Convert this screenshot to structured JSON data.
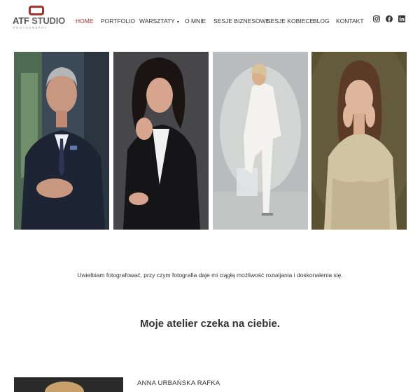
{
  "brand": {
    "logo_text_1": "ATF",
    "logo_text_2": "STUDIO",
    "logo_sub": "PHOTOGRAPHY",
    "accent": "#a8322d"
  },
  "nav": {
    "items": [
      {
        "label": "HOME",
        "active": true
      },
      {
        "label": "PORTFOLIO",
        "active": false
      },
      {
        "label": "WARSZTATY",
        "active": false,
        "has_dropdown": true
      },
      {
        "label": "O MNIE",
        "active": false
      },
      {
        "label": "SESJE BIZNESOWE",
        "active": false
      },
      {
        "label": "SESJE KOBIECE",
        "active": false
      },
      {
        "label": "BLOG",
        "active": false
      },
      {
        "label": "KONTAKT",
        "active": false
      }
    ],
    "dropdown_caret": "▾"
  },
  "social": {
    "icons": [
      "instagram-icon",
      "facebook-icon",
      "linkedin-icon"
    ]
  },
  "gallery": {
    "photos": [
      "portrait-man-suit",
      "portrait-woman-black-suit",
      "portrait-woman-white-suit",
      "portrait-woman-beige-dress"
    ]
  },
  "intro_text": "Uwielbiam fotografować, przy czym fotografia daje mi ciągłą możliwość rozwijania i doskonalenia się.",
  "headline": "Moje atelier czeka na ciebie.",
  "profile": {
    "name": "ANNA URBAŃSKA RAFKA"
  }
}
